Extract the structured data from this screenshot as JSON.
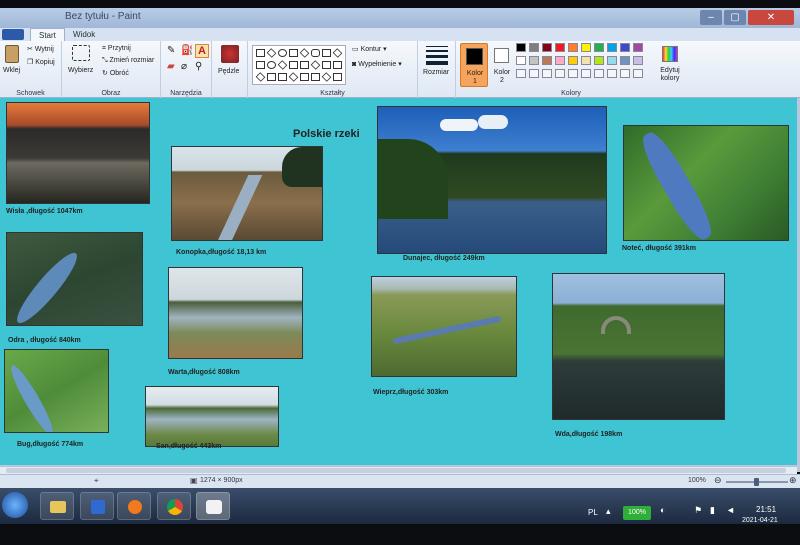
{
  "window": {
    "title": "Bez tytułu - Paint"
  },
  "tabs": [
    "Start",
    "Widok"
  ],
  "ribbon": {
    "clipboard": {
      "paste": "Wklej",
      "cut": "Wytnij",
      "copy": "Kopiuj",
      "label": "Schowek"
    },
    "image": {
      "select": "Wybierz",
      "crop": "Przytnij",
      "resize": "Zmień rozmiar",
      "rotate": "Obróć",
      "label": "Obraz"
    },
    "tools": {
      "label": "Narzędzia"
    },
    "brushes": {
      "label": "Pędzle"
    },
    "shapes": {
      "outline": "Kontur",
      "fill": "Wypełnienie",
      "label": "Kształty"
    },
    "size": {
      "label": "Rozmiar"
    },
    "colors": {
      "color1": "Kolor 1",
      "color2": "Kolor 2",
      "edit": "Edytuj kolory",
      "label": "Kolory",
      "palette": [
        "#000000",
        "#7f7f7f",
        "#880015",
        "#ed1c24",
        "#ff7f27",
        "#fff200",
        "#22b14c",
        "#00a2e8",
        "#3f48cc",
        "#a349a4",
        "#ffffff",
        "#c3c3c3",
        "#b97a57",
        "#ffaec9",
        "#ffc90e",
        "#efe4b0",
        "#b5e61d",
        "#99d9ea",
        "#7092be",
        "#c8bfe7"
      ]
    }
  },
  "canvas": {
    "heading": "Polskie rzeki",
    "rivers": [
      {
        "caption": "Wisła ,długość 1047km"
      },
      {
        "caption": "Konopka,długość 18,13 km"
      },
      {
        "caption": "Dunajec, długość 249km"
      },
      {
        "caption": "Noteć, długość 391km"
      },
      {
        "caption": "Odra , długość  840km"
      },
      {
        "caption": "Warta,długość 808km"
      },
      {
        "caption": "Wieprz,długość 303km"
      },
      {
        "caption": "Wda,długość 198km"
      },
      {
        "caption": "Bug,długość 774km"
      },
      {
        "caption": "San,długość 443km"
      }
    ]
  },
  "statusbar": {
    "dimensions": "1274 × 900px",
    "zoom": "100%"
  },
  "taskbar": {
    "language": "PL",
    "battery": "100%",
    "time": "21:51",
    "date": "2021-04-21"
  }
}
